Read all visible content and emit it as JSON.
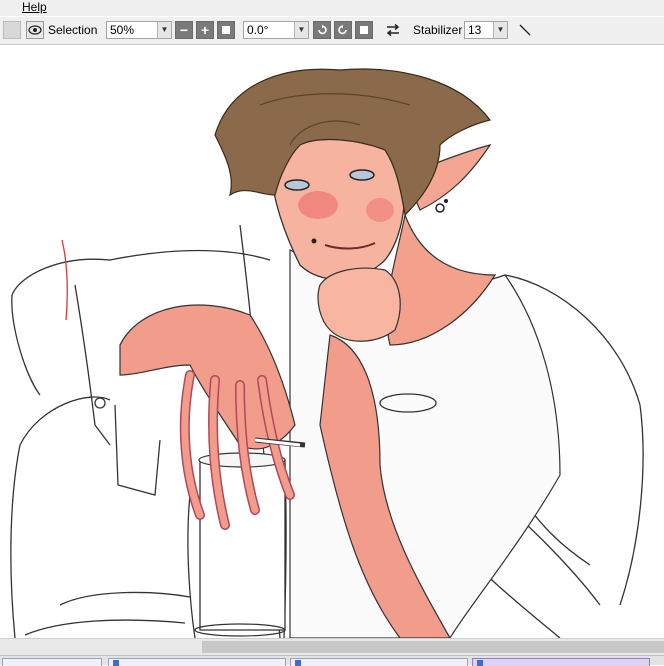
{
  "menubar": {
    "help_label": "Help"
  },
  "toolbar": {
    "selection_label": "Selection",
    "zoom_value": "50%",
    "rotation_value": "0.0°",
    "stabilizer_label": "Stabilizer",
    "stabilizer_value": "13",
    "icons": [
      "eye-icon",
      "minus-icon",
      "plus-icon",
      "reset-icon",
      "rotate-left-icon",
      "rotate-right-icon",
      "reset-rotation-icon",
      "flip-horizontal-icon",
      "pen-line-icon"
    ]
  },
  "colors": {
    "toolbar_bg": "#f0f0f0",
    "hair": "#8a6a4a",
    "skin": "#e88a7a",
    "line": "#222222"
  }
}
